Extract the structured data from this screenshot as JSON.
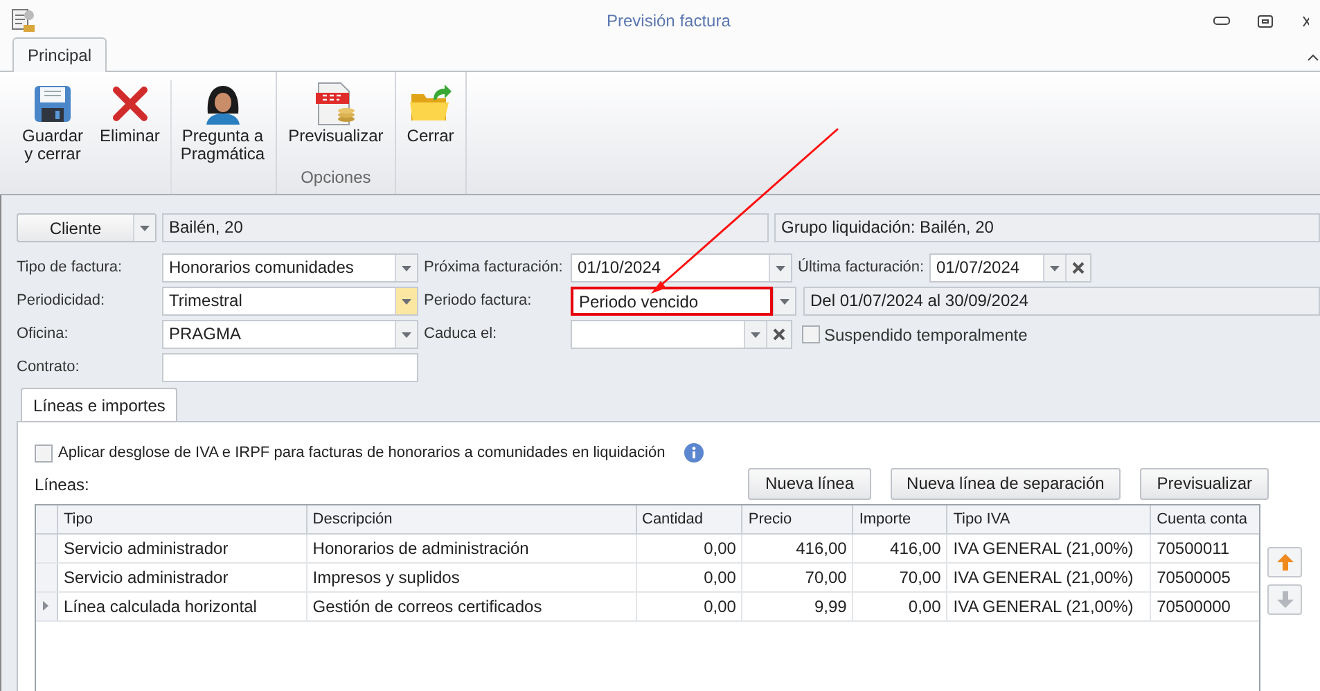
{
  "window": {
    "title": "Previsión factura"
  },
  "ribbon": {
    "tabs": [
      {
        "label": "Principal",
        "selected": true
      }
    ],
    "groups": [
      {
        "buttons": [
          {
            "kind": "save",
            "lines": [
              "Guardar",
              "y cerrar"
            ]
          },
          {
            "kind": "delete",
            "lines": [
              "Eliminar"
            ]
          },
          {
            "kind": "assistant",
            "lines": [
              "Pregunta a",
              "Pragmática"
            ]
          }
        ]
      },
      {
        "label": "Opciones",
        "buttons": [
          {
            "kind": "pdf",
            "lines": [
              "Previsualizar"
            ]
          }
        ]
      },
      {
        "buttons": [
          {
            "kind": "close",
            "lines": [
              "Cerrar"
            ]
          }
        ]
      }
    ]
  },
  "client": {
    "button": "Cliente",
    "value": "Bailén, 20",
    "group": "Grupo liquidación: Bailén, 20"
  },
  "form": {
    "tipo_factura": {
      "label": "Tipo de factura:",
      "value": "Honorarios comunidades"
    },
    "proxima": {
      "label": "Próxima facturación:",
      "value": "01/10/2024"
    },
    "ultima": {
      "label": "Última facturación:",
      "value": "01/07/2024"
    },
    "periodicidad": {
      "label": "Periodicidad:",
      "value": "Trimestral",
      "hovered": true
    },
    "periodo": {
      "label": "Periodo factura:",
      "value": "Periodo vencido",
      "annotated": true
    },
    "periodo_range": "Del 01/07/2024 al 30/09/2024",
    "oficina": {
      "label": "Oficina:",
      "value": "PRAGMA"
    },
    "caduca": {
      "label": "Caduca el:"
    },
    "suspendido": {
      "label": "Suspendido temporalmente",
      "checked": false
    },
    "contrato": {
      "label": "Contrato:"
    }
  },
  "inner_tabs": [
    {
      "label": "Líneas e importes",
      "selected": true
    }
  ],
  "desglose": {
    "label": "Aplicar desglose de IVA e IRPF para facturas de honorarios a comunidades en liquidación",
    "checked": false
  },
  "lines_label": "Líneas:",
  "line_buttons": [
    "Nueva línea",
    "Nueva línea de separación",
    "Previsualizar"
  ],
  "table": {
    "columns": [
      "Tipo",
      "Descripción",
      "Cantidad",
      "Precio",
      "Importe",
      "Tipo IVA",
      "Cuenta conta"
    ],
    "rows": [
      {
        "current": false,
        "cells": [
          "Servicio administrador",
          "Honorarios de administración",
          "0,00",
          "416,00",
          "416,00",
          "IVA GENERAL (21,00%)",
          "70500011"
        ]
      },
      {
        "current": false,
        "cells": [
          "Servicio administrador",
          "Impresos y suplidos",
          "0,00",
          "70,00",
          "70,00",
          "IVA GENERAL (21,00%)",
          "70500005"
        ]
      },
      {
        "current": true,
        "cells": [
          "Línea calculada horizontal",
          "Gestión de correos certificados",
          "0,00",
          "9,99",
          "0,00",
          "IVA GENERAL (21,00%)",
          "70500000"
        ]
      }
    ]
  },
  "move_buttons": [
    {
      "kind": "up",
      "disabled": false
    },
    {
      "kind": "down",
      "disabled": true
    }
  ]
}
